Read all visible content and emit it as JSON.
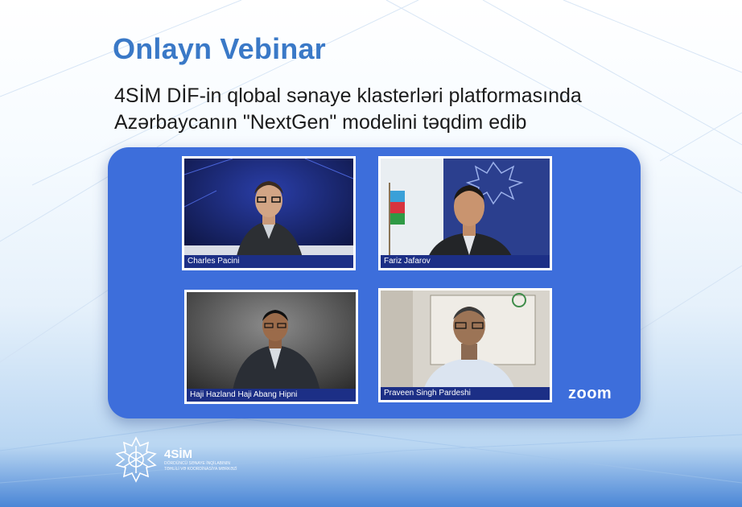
{
  "header": {
    "title": "Onlayn Vebinar",
    "subtitle_line1": "4SİM DİF-in qlobal sənaye klasterləri platformasında",
    "subtitle_line2": "Azərbaycanın \"NextGen\" modelini təqdim edib"
  },
  "participants": [
    {
      "name": "Charles Pacini"
    },
    {
      "name": "Fariz Jafarov"
    },
    {
      "name": "Haji Hazland Haji Abang Hipni"
    },
    {
      "name": "Praveen Singh Pardeshi"
    }
  ],
  "zoom_brand": "zoom",
  "footer_logo": {
    "name": "4SİM",
    "tagline_line1": "DÖRDÜNCÜ SƏNAYE İNQİLABININ",
    "tagline_line2": "TƏHLİLİ VƏ KOORDİNASİYA MƏRKƏZİ",
    "icon": "snowflake-ornament-icon"
  },
  "colors": {
    "title": "#3a79c7",
    "panel": "#3d6edb",
    "name_bar": "#1c2f86"
  }
}
